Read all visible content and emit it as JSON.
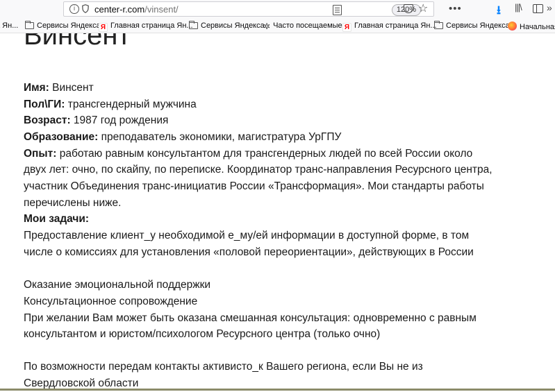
{
  "browser": {
    "url_host": "center-r.com",
    "url_path": "/vinsent/",
    "zoom": "120%",
    "bookmarks": [
      {
        "icon": "folder-icon",
        "label": "а Ян..."
      },
      {
        "icon": "folder-icon",
        "label": "Сервисы Яндекса"
      },
      {
        "icon": "yandex-icon",
        "label": "Главная страница Ян..."
      },
      {
        "icon": "folder-icon",
        "label": "Сервисы Яндекса"
      },
      {
        "icon": "gear-icon",
        "label": "Часто посещаемые"
      },
      {
        "icon": "yandex-icon",
        "label": "Главная страница Ян..."
      },
      {
        "icon": "folder-icon",
        "label": "Сервисы Яндекса"
      },
      {
        "icon": "firefox-icon",
        "label": "Начальная"
      }
    ]
  },
  "page": {
    "title": "Винсент",
    "name_label": "Имя:",
    "name_value": " Винсент",
    "gender_label": "Пол\\ГИ:",
    "gender_value": " трансгендерный мужчина",
    "age_label": "Возраст:",
    "age_value": " 1987 год рождения",
    "education_label": "Образование:",
    "education_value": " преподаватель экономики, магистратура УрГПУ",
    "experience_label": "Опыт:",
    "experience_line1": " работаю равным консультантом для трансгендерных людей по всей России около",
    "experience_line2": "двух лет: очно, по скайпу, по переписке. Координатор транс-направления Ресурсного центра,",
    "experience_line3": "участник Объединения транс-инициатив России «Трансформация». Мои стандарты работы",
    "experience_line4": "перечислены ниже.",
    "tasks_label": "Мои задачи:",
    "task1_line1": "Предоставление клиент_у необходимой е_му/ей информации в доступной форме, в том",
    "task1_line2": "числе о комиссиях для установления «половой переориентации», действующих в России",
    "task2": "Оказание эмоциональной поддержки",
    "task3": "Консультационное сопровождение",
    "task4_line1": "При желании Вам может быть оказана смешанная консультация: одновременно с равным",
    "task4_line2": "консультантом и юристом/психологом Ресурсного центра (только очно)",
    "task5_line1": "По возможности передам контакты активисто_к Вашего региона, если Вы не из",
    "task5_line2": "Свердловской области"
  }
}
